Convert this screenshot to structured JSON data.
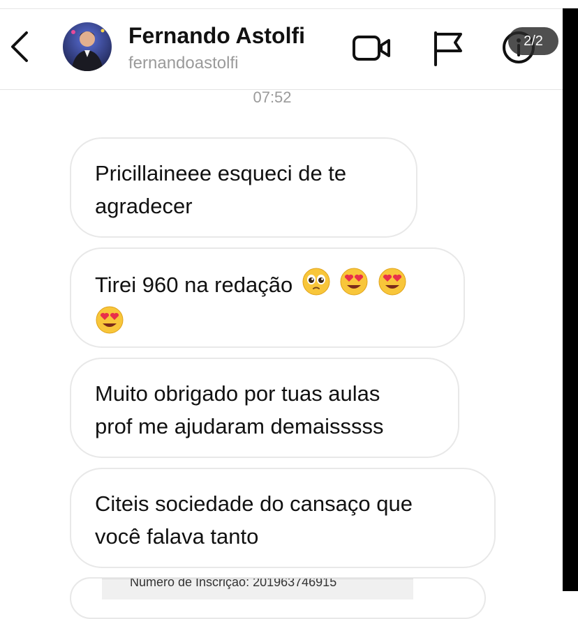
{
  "header": {
    "name": "Fernando Astolfi",
    "username": "fernandoastolfi",
    "page_indicator": "2/2"
  },
  "timestamp": "07:52",
  "messages": [
    {
      "line1": "Pricillaineee esqueci de te",
      "line2": "agradecer"
    },
    {
      "line1": "Tirei 960 na redação",
      "emojis": [
        "pleading-face",
        "heart-eyes",
        "heart-eyes",
        "heart-eyes"
      ]
    },
    {
      "line1": "Muito obrigado por tuas aulas",
      "line2": "prof me ajudaram demaisssss"
    },
    {
      "line1": "Citeis sociedade do cansaço que",
      "line2": "você falava tanto"
    }
  ],
  "attachment": {
    "text": "Número de Inscrição: 201963746915"
  }
}
